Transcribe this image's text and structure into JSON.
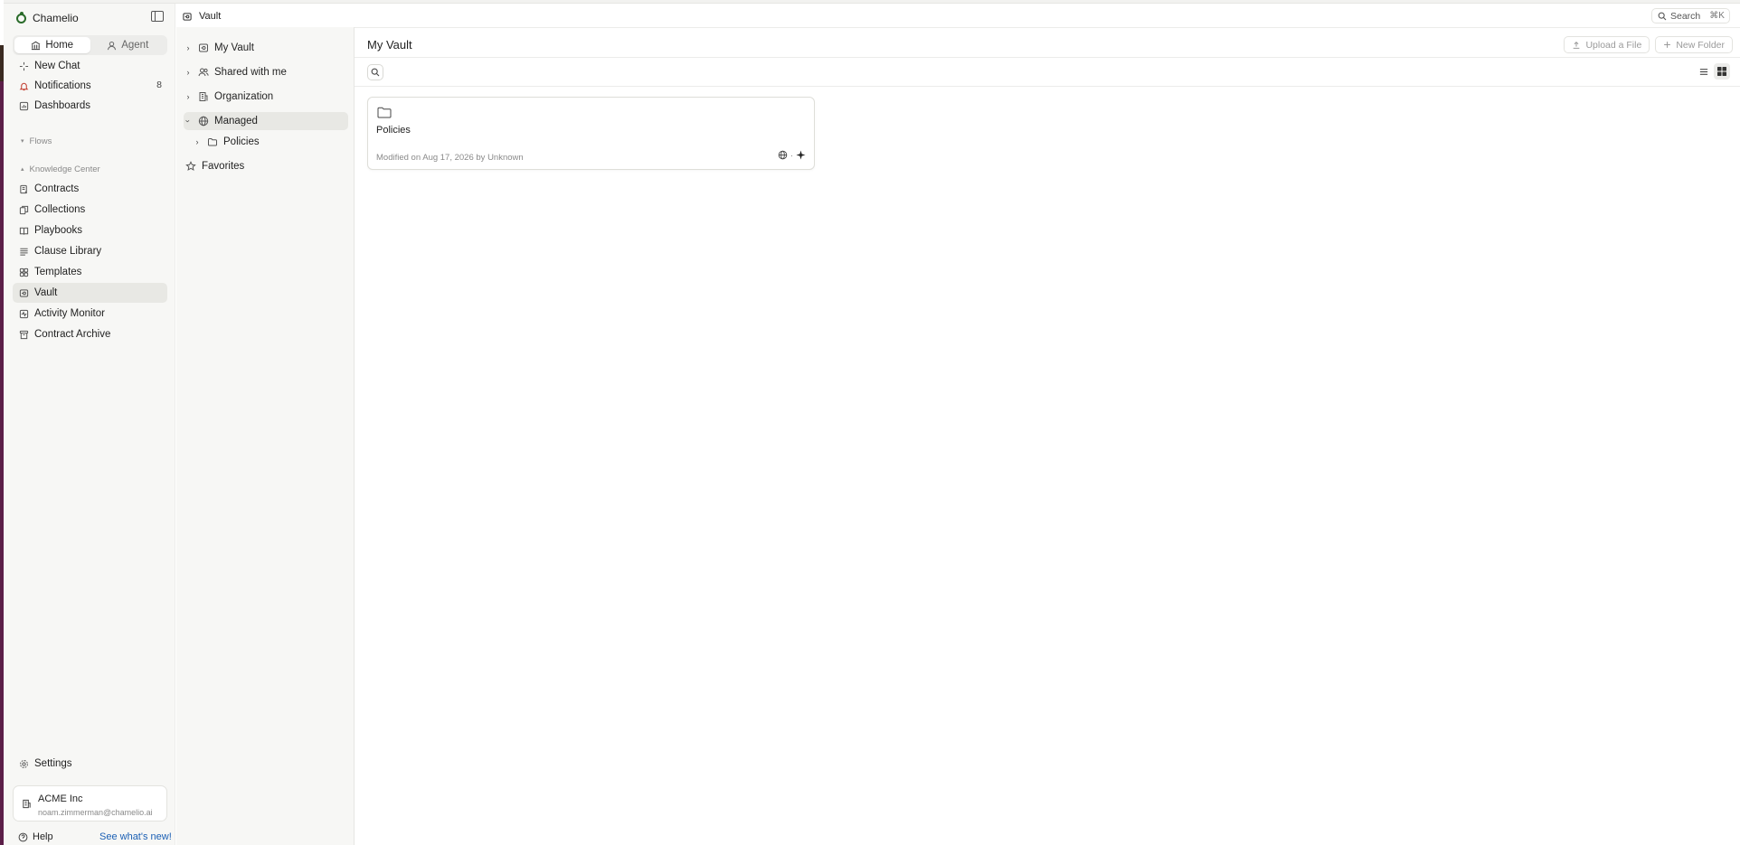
{
  "brand": {
    "name": "Chamelio"
  },
  "mode": {
    "home": "Home",
    "agent": "Agent"
  },
  "nav": {
    "new_chat": "New Chat",
    "notifications": "Notifications",
    "notifications_count": "8",
    "dashboards": "Dashboards",
    "flows": "Flows",
    "knowledge_center": "Knowledge Center",
    "contracts": "Contracts",
    "collections": "Collections",
    "playbooks": "Playbooks",
    "clause_library": "Clause Library",
    "templates": "Templates",
    "vault": "Vault",
    "activity_monitor": "Activity Monitor",
    "contract_archive": "Contract Archive",
    "settings": "Settings"
  },
  "org": {
    "name": "ACME Inc",
    "email": "noam.zimmerman@chamelio.ai"
  },
  "footer": {
    "help": "Help",
    "whats_new": "See what's new!"
  },
  "header": {
    "breadcrumb": "Vault",
    "search": "Search",
    "shortcut": "⌘K"
  },
  "tree": {
    "my_vault": "My Vault",
    "shared": "Shared with me",
    "organization": "Organization",
    "managed": "Managed",
    "policies": "Policies",
    "favorites": "Favorites"
  },
  "main": {
    "title": "My Vault",
    "upload": "Upload a File",
    "new_folder": "New Folder"
  },
  "card": {
    "name": "Policies",
    "meta": "Modified on Aug 17, 2026 by Unknown",
    "separator": "·"
  }
}
